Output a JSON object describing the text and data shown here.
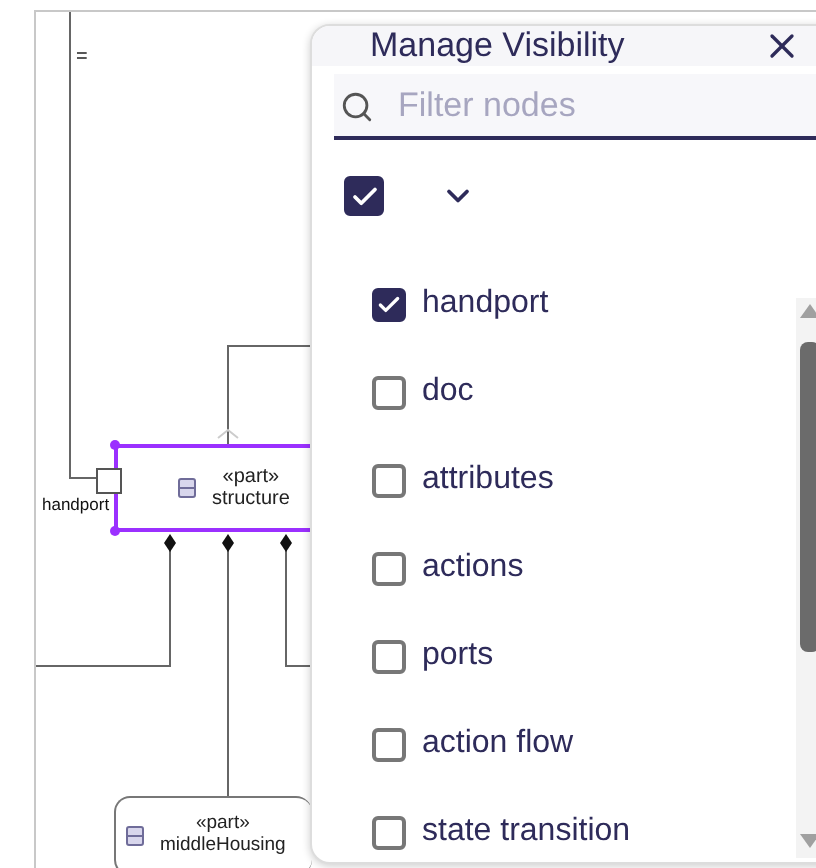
{
  "diagram": {
    "equation_label": "=",
    "port": {
      "label": "handport"
    },
    "nodes": [
      {
        "stereotype": "«part»",
        "name": "structure",
        "selected": true
      },
      {
        "stereotype": "«part»",
        "name": "middleHousing",
        "selected": false
      }
    ]
  },
  "panel": {
    "title": "Manage Visibility",
    "search": {
      "placeholder": "Filter nodes"
    },
    "select_all": {
      "checked": true
    },
    "items": [
      {
        "label": "handport",
        "checked": true
      },
      {
        "label": "doc",
        "checked": false
      },
      {
        "label": "attributes",
        "checked": false
      },
      {
        "label": "actions",
        "checked": false
      },
      {
        "label": "ports",
        "checked": false
      },
      {
        "label": "action flow",
        "checked": false
      },
      {
        "label": "state transition",
        "checked": false
      }
    ]
  }
}
